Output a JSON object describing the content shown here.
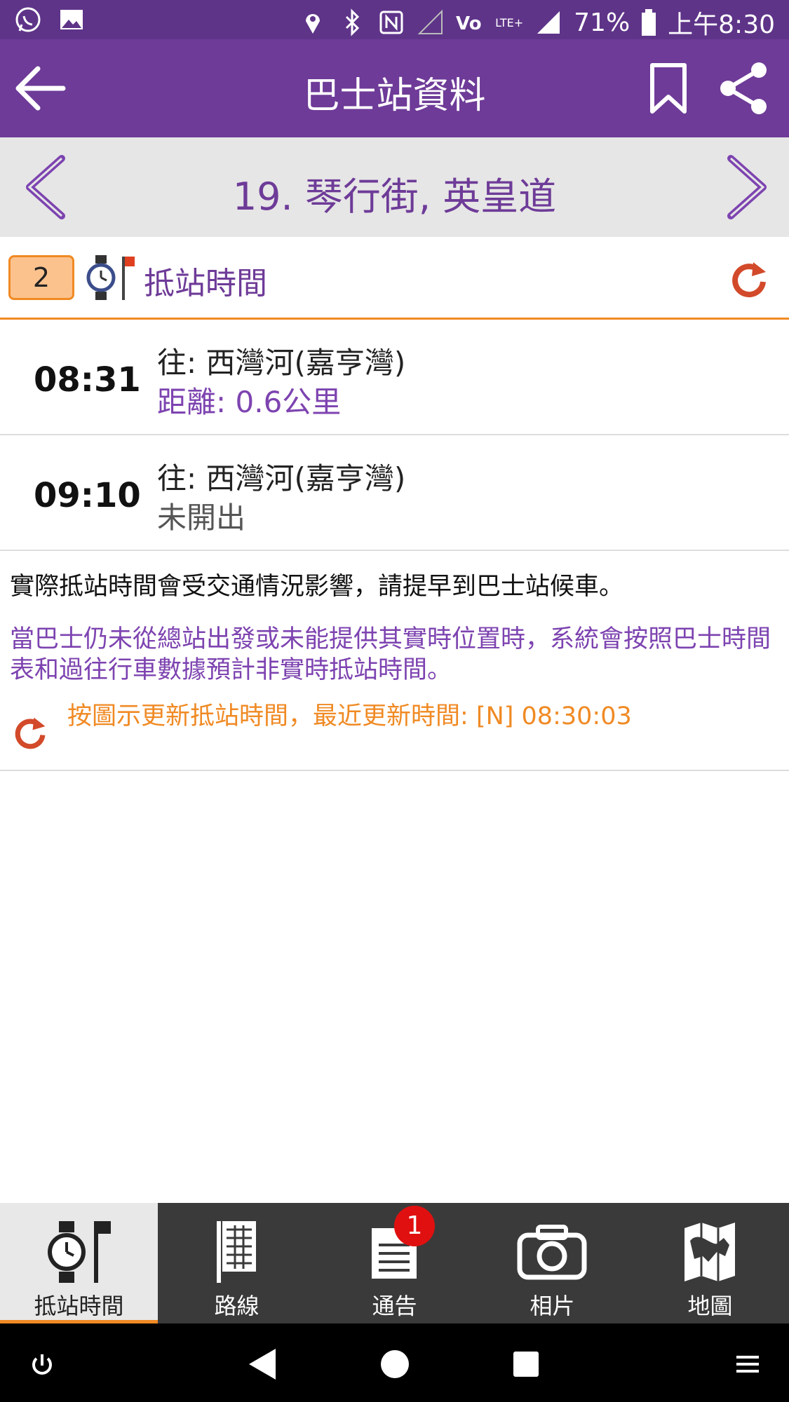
{
  "status_bar": {
    "battery": "71%",
    "time": "上午8:30",
    "network_label": "LTE+"
  },
  "app_bar": {
    "title": "巴士站資料"
  },
  "stop_nav": {
    "stop_name": "19. 琴行街, 英皇道"
  },
  "eta_header": {
    "count": "2",
    "label": "抵站時間"
  },
  "eta_rows": [
    {
      "time": "08:31",
      "destination": "往: 西灣河(嘉亨灣)",
      "info": "距離: 0.6公里"
    },
    {
      "time": "09:10",
      "destination": "往: 西灣河(嘉亨灣)",
      "info": "未開出"
    }
  ],
  "notes": {
    "traffic_note": "實際抵站時間會受交通情況影響，請提早到巴士站候車。",
    "schedule_note": "當巴士仍未從總站出發或未能提供其實時位置時，系統會按照巴士時間表和過往行車數據預計非實時抵站時間。",
    "update_note": "按圖示更新抵站時間，最近更新時間: [N] 08:30:03"
  },
  "tabs": [
    {
      "label": "抵站時間",
      "icon": "clock-flag-icon",
      "active": true
    },
    {
      "label": "路線",
      "icon": "route-grid-icon",
      "active": false
    },
    {
      "label": "通告",
      "icon": "notice-icon",
      "active": false
    },
    {
      "label": "相片",
      "icon": "camera-icon",
      "active": false
    },
    {
      "label": "地圖",
      "icon": "map-icon",
      "active": false
    }
  ],
  "notice_badge": "1",
  "colors": {
    "primary": "#6e3b98",
    "accent": "#f08a24",
    "purple_text": "#7d43b0",
    "tab_bar": "#3a3a3a"
  }
}
